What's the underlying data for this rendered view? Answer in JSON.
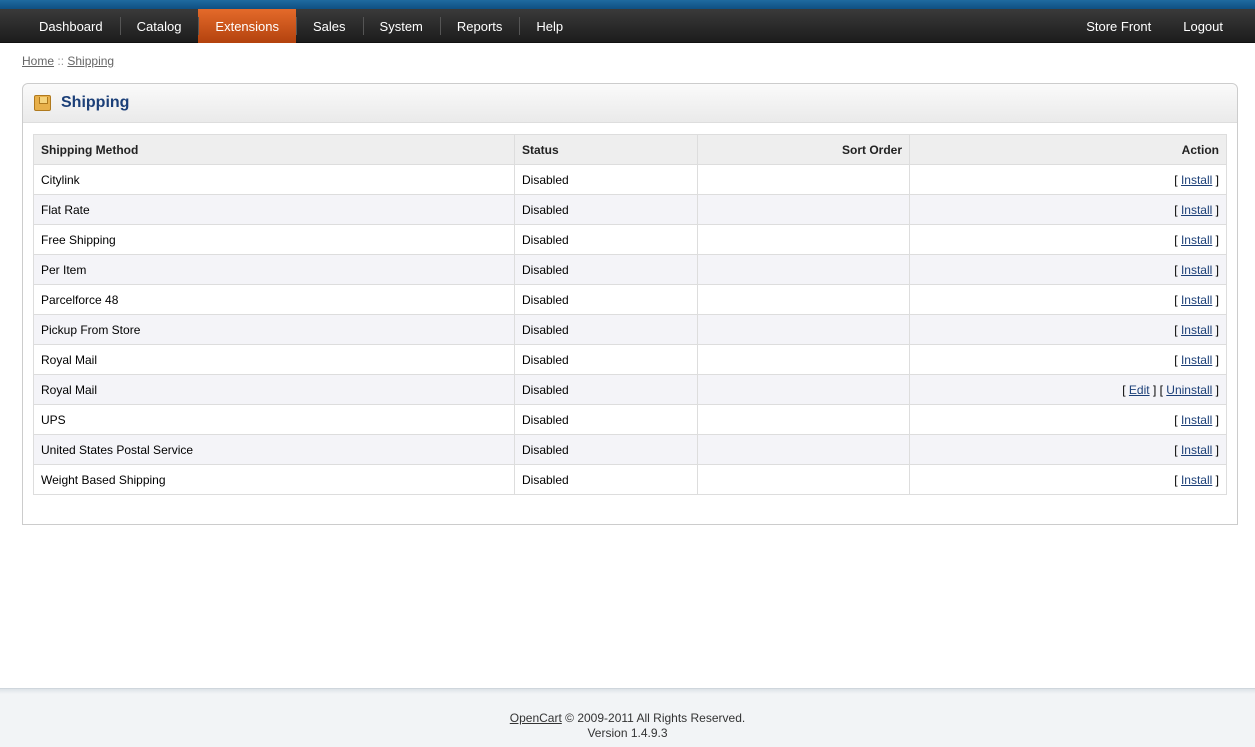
{
  "menu": {
    "left": [
      "Dashboard",
      "Catalog",
      "Extensions",
      "Sales",
      "System",
      "Reports",
      "Help"
    ],
    "right": [
      "Store Front",
      "Logout"
    ],
    "active": "Extensions"
  },
  "breadcrumb": {
    "home": "Home",
    "separator": "::",
    "current": "Shipping"
  },
  "box": {
    "title": "Shipping"
  },
  "table": {
    "headers": {
      "method": "Shipping Method",
      "status": "Status",
      "sort_order": "Sort Order",
      "action": "Action"
    },
    "rows": [
      {
        "method": "Citylink",
        "status": "Disabled",
        "sort_order": "",
        "actions": [
          "Install"
        ]
      },
      {
        "method": "Flat Rate",
        "status": "Disabled",
        "sort_order": "",
        "actions": [
          "Install"
        ]
      },
      {
        "method": "Free Shipping",
        "status": "Disabled",
        "sort_order": "",
        "actions": [
          "Install"
        ]
      },
      {
        "method": "Per Item",
        "status": "Disabled",
        "sort_order": "",
        "actions": [
          "Install"
        ]
      },
      {
        "method": "Parcelforce 48",
        "status": "Disabled",
        "sort_order": "",
        "actions": [
          "Install"
        ]
      },
      {
        "method": "Pickup From Store",
        "status": "Disabled",
        "sort_order": "",
        "actions": [
          "Install"
        ]
      },
      {
        "method": "Royal Mail",
        "status": "Disabled",
        "sort_order": "",
        "actions": [
          "Install"
        ]
      },
      {
        "method": "Royal Mail",
        "status": "Disabled",
        "sort_order": "",
        "actions": [
          "Edit",
          "Uninstall"
        ]
      },
      {
        "method": "UPS",
        "status": "Disabled",
        "sort_order": "",
        "actions": [
          "Install"
        ]
      },
      {
        "method": "United States Postal Service",
        "status": "Disabled",
        "sort_order": "",
        "actions": [
          "Install"
        ]
      },
      {
        "method": "Weight Based Shipping",
        "status": "Disabled",
        "sort_order": "",
        "actions": [
          "Install"
        ]
      }
    ]
  },
  "footer": {
    "link": "OpenCart",
    "copyright": "© 2009-2011 All Rights Reserved.",
    "version": "Version 1.4.9.3"
  },
  "colors": {
    "accent": "#e46a2a",
    "link": "#1b3f78",
    "top_stripe": "#1f6aa0"
  }
}
